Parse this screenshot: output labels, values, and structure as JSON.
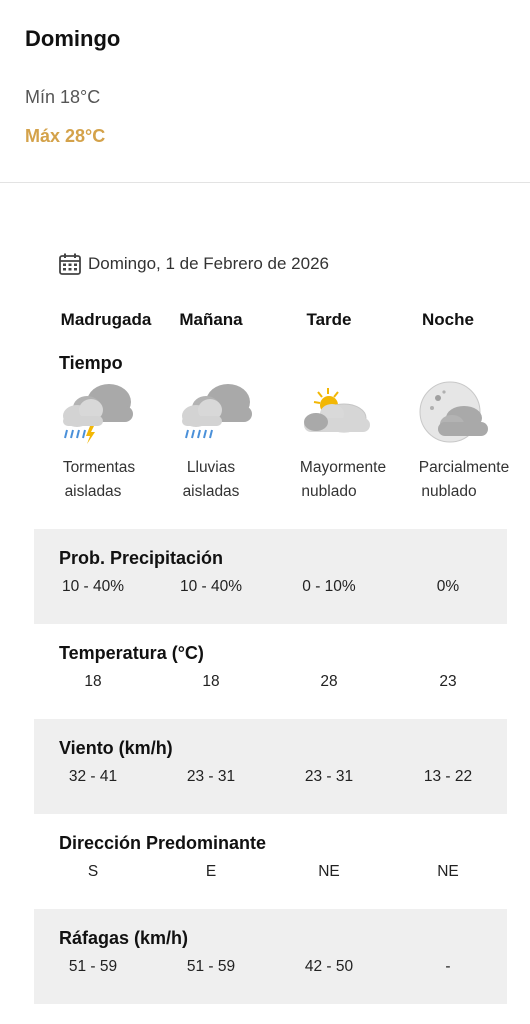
{
  "summary": {
    "day": "Domingo",
    "min": "Mín 18°C",
    "max": "Máx 28°C",
    "max_color": "#d4a24a"
  },
  "date_line": {
    "icon": "calendar-icon",
    "text": "Domingo, 1 de Febrero de 2026"
  },
  "periods": [
    "Madrugada",
    "Mañana",
    "Tarde",
    "Noche"
  ],
  "tiempo": {
    "label": "Tiempo",
    "items": [
      {
        "icon": "thunderstorm-rain-icon",
        "line1": "Tormentas",
        "line2": "aisladas"
      },
      {
        "icon": "rain-cloud-icon",
        "line1": "Lluvias",
        "line2": "aisladas"
      },
      {
        "icon": "mostly-cloudy-sun-icon",
        "line1": "Mayormente",
        "line2": "nublado"
      },
      {
        "icon": "partly-cloudy-moon-icon",
        "line1": "Parcialmente",
        "line2": "nublado"
      }
    ]
  },
  "rows": [
    {
      "title": "Prob. Precipitación",
      "values": [
        "10 - 40%",
        "10 - 40%",
        "0 - 10%",
        "0%"
      ]
    },
    {
      "title": "Temperatura (°C)",
      "values": [
        "18",
        "18",
        "28",
        "23"
      ]
    },
    {
      "title": "Viento (km/h)",
      "values": [
        "32 - 41",
        "23 - 31",
        "23 - 31",
        "13 - 22"
      ]
    },
    {
      "title": "Dirección Predominante",
      "values": [
        "S",
        "E",
        "NE",
        "NE"
      ]
    },
    {
      "title": "Ráfagas (km/h)",
      "values": [
        "51 - 59",
        "51 - 59",
        "42 - 50",
        "-"
      ]
    }
  ],
  "colors": {
    "shaded_row": "#efefef",
    "cloud_gray": "#b9b9b9",
    "rain_blue": "#4a90d9",
    "sun_yellow": "#f2b705"
  }
}
